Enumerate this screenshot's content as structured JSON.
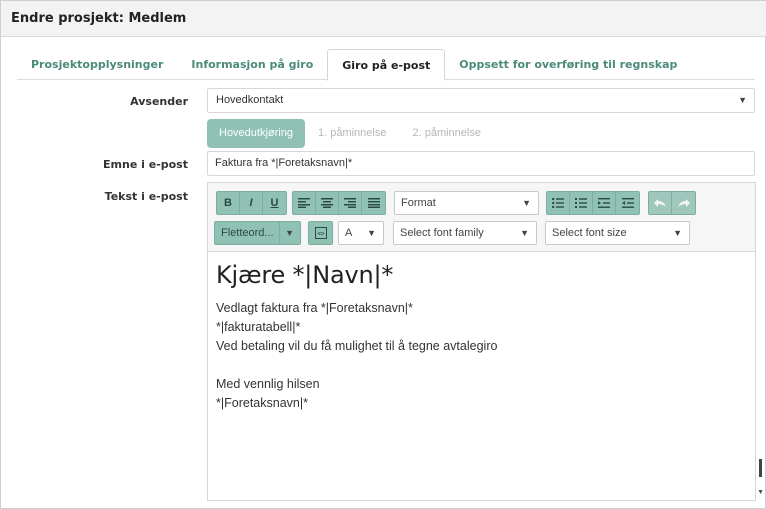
{
  "window": {
    "title": "Endre prosjekt: Medlem"
  },
  "tabs": [
    {
      "label": "Prosjektopplysninger",
      "active": false
    },
    {
      "label": "Informasjon på giro",
      "active": false
    },
    {
      "label": "Giro på e-post",
      "active": true
    },
    {
      "label": "Oppsett for overføring til regnskap",
      "active": false
    }
  ],
  "form": {
    "sender_label": "Avsender",
    "sender_value": "Hovedkontakt",
    "subject_label": "Emne i e-post",
    "subject_value": "Faktura fra *|Foretaksnavn|*",
    "body_label": "Tekst i e-post"
  },
  "subtabs": [
    {
      "label": "Hovedutkjøring",
      "active": true
    },
    {
      "label": "1. påminnelse",
      "active": false
    },
    {
      "label": "2. påminnelse",
      "active": false
    }
  ],
  "toolbar": {
    "bold": "B",
    "italic": "I",
    "underline": "U",
    "format_label": "Format",
    "merge_label": "Fletteord...",
    "text_color_label": "A",
    "font_family_label": "Select font family",
    "font_size_label": "Select font size"
  },
  "editor": {
    "heading": "Kjære *|Navn|*",
    "lines": [
      "Vedlagt faktura fra *|Foretaksnavn|*",
      "*|fakturatabell|*",
      "Ved betaling vil du få mulighet til å tegne avtalegiro",
      "",
      "Med vennlig hilsen",
      "*|Foretaksnavn|*"
    ]
  },
  "colors": {
    "accent": "#8fc2b4",
    "tab_link": "#4a8a7b"
  }
}
